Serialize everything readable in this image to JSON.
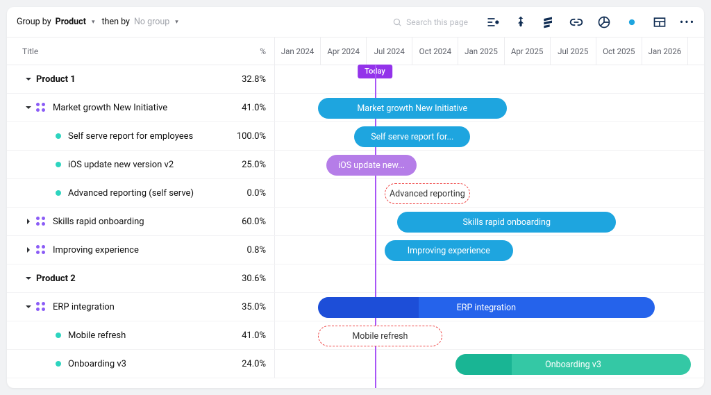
{
  "toolbar": {
    "groupby_label": "Group by",
    "groupby_value": "Product",
    "thenby_label": "then by",
    "thenby_value": "No group",
    "search_placeholder": "Search this page"
  },
  "columns": {
    "title": "Title",
    "pct": "%"
  },
  "timeline": {
    "headers": [
      "Jan 2024",
      "Apr 2024",
      "Jul 2024",
      "Oct 2024",
      "Jan 2025",
      "Apr 2025",
      "Jul 2025",
      "Oct 2025",
      "Jan 2026"
    ],
    "today_label": "Today",
    "today_pos_pct": 23.3
  },
  "rows": [
    {
      "kind": "group",
      "name": "Product 1",
      "pct": "32.8%"
    },
    {
      "kind": "epic",
      "name": "Market growth New Initiative",
      "pct": "41.0%",
      "expanded": true
    },
    {
      "kind": "item",
      "name": "Self serve report for employees",
      "pct": "100.0%"
    },
    {
      "kind": "item",
      "name": "iOS update new version v2",
      "pct": "25.0%"
    },
    {
      "kind": "item",
      "name": "Advanced reporting (self serve)",
      "pct": "0.0%"
    },
    {
      "kind": "epic",
      "name": "Skills rapid onboarding",
      "pct": "60.0%",
      "expanded": false
    },
    {
      "kind": "epic",
      "name": "Improving experience",
      "pct": "0.8%",
      "expanded": false
    },
    {
      "kind": "group",
      "name": "Product 2",
      "pct": "30.6%"
    },
    {
      "kind": "epic",
      "name": "ERP integration",
      "pct": "35.0%",
      "expanded": true
    },
    {
      "kind": "item",
      "name": "Mobile refresh",
      "pct": "41.0%"
    },
    {
      "kind": "item",
      "name": "Onboarding v3",
      "pct": "24.0%"
    }
  ],
  "bars": {
    "b1": "Market growth New Initiative",
    "b2": "Self serve report for...",
    "b3": "iOS update new...",
    "b4": "Advanced reporting",
    "b5": "Skills rapid onboarding",
    "b6": "Improving experience",
    "b7": "ERP integration",
    "b8": "Mobile refresh",
    "b9": "Onboarding v3"
  },
  "chart_data": {
    "type": "gantt",
    "x_axis": {
      "start": "2024-01",
      "end": "2026-03",
      "tick_interval": "quarter"
    },
    "today": "2024-07-20",
    "tasks": [
      {
        "name": "Market growth New Initiative",
        "start": "2024-04",
        "end": "2025-01",
        "progress": 41.0,
        "color": "#1ea5df"
      },
      {
        "name": "Self serve report for employees",
        "start": "2024-06",
        "end": "2024-12",
        "progress": 100.0,
        "color": "#1ea5df"
      },
      {
        "name": "iOS update new version v2",
        "start": "2024-04",
        "end": "2024-10",
        "progress": 25.0,
        "color": "#b57de8"
      },
      {
        "name": "Advanced reporting (self serve)",
        "start": "2024-08",
        "end": "2025-01",
        "progress": 0.0,
        "style": "dashed",
        "color": "#ef4444"
      },
      {
        "name": "Skills rapid onboarding",
        "start": "2024-09",
        "end": "2025-10",
        "progress": 60.0,
        "color": "#1ea5df"
      },
      {
        "name": "Improving experience",
        "start": "2024-08",
        "end": "2025-05",
        "progress": 0.8,
        "color": "#1ea5df"
      },
      {
        "name": "ERP integration",
        "start": "2024-04",
        "end": "2026-01",
        "progress": 35.0,
        "color": "#2563eb"
      },
      {
        "name": "Mobile refresh",
        "start": "2024-04",
        "end": "2024-11",
        "progress": 41.0,
        "style": "dashed",
        "color": "#ef4444"
      },
      {
        "name": "Onboarding v3",
        "start": "2024-12",
        "end": "2026-03",
        "progress": 24.0,
        "color": "#34c8a5"
      }
    ]
  }
}
